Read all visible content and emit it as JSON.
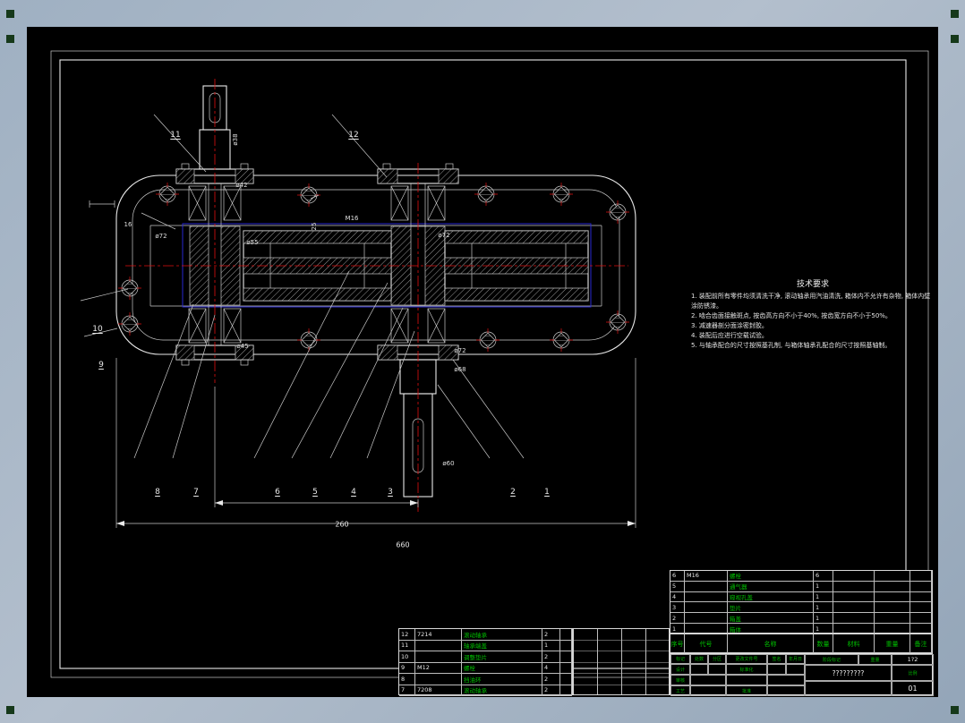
{
  "scene": {
    "background": "#a9b6c5",
    "canvas": "#000000",
    "line_color": "#e8e8e8",
    "centerline_color": "#e01010",
    "gear_box_color": "#2828d0",
    "table_text_color": "#00c000"
  },
  "callouts": [
    "1",
    "2",
    "3",
    "4",
    "5",
    "6",
    "7",
    "8",
    "9",
    "10",
    "11",
    "12"
  ],
  "dims": {
    "center_distance": "260",
    "overall_width": "660",
    "left_offset": "16",
    "left_dia": "ø72"
  },
  "labels": {
    "shaft_end": "ø38",
    "shaft_step": "ø42",
    "bearing_seat_top": "ø55",
    "bearing_seat_bottom": "ø45",
    "bolt_spec": "M16",
    "cap_depth": "25",
    "out_top": "ø72",
    "out_seat": "ø72",
    "out_cap": "ø68",
    "out_end": "ø60"
  },
  "tech": {
    "title": "技术要求",
    "lines": [
      "1. 装配前所有零件均须清洗干净, 滚动轴承用汽油清洗, 箱体内不允许有杂物, 箱体内壁涂防锈漆。",
      "2. 啮合齿面接触斑点, 按齿高方向不小于40%, 按齿宽方向不小于50%。",
      "3. 减速器剖分面涂密封胶。",
      "4. 装配后应进行空载试验。",
      "5. 与轴承配合的尺寸按照基孔制, 与箱体轴承孔配合的尺寸按照基轴制。"
    ]
  },
  "bom_left": {
    "rows": [
      [
        "12",
        "7214",
        "滚动轴承",
        "2",
        ""
      ],
      [
        "11",
        "",
        "轴承端盖",
        "1",
        ""
      ],
      [
        "10",
        "",
        "调整垫片",
        "2",
        ""
      ],
      [
        "9",
        "M12",
        "螺栓",
        "4",
        ""
      ],
      [
        "8",
        "",
        "挡油环",
        "2",
        ""
      ],
      [
        "7",
        "7208",
        "滚动轴承",
        "2",
        ""
      ]
    ]
  },
  "bom_right": {
    "header": [
      [
        "序号",
        "代号",
        "名称",
        "数量",
        "材料",
        "重量",
        "备注"
      ]
    ],
    "rows": [
      [
        "6",
        "M16",
        "螺栓",
        "6",
        "",
        "",
        ""
      ],
      [
        "5",
        "",
        "通气器",
        "1",
        "",
        "",
        ""
      ],
      [
        "4",
        "",
        "窥视孔盖",
        "1",
        "",
        "",
        ""
      ],
      [
        "3",
        "",
        "垫片",
        "1",
        "",
        "",
        ""
      ],
      [
        "2",
        "",
        "箱盖",
        "1",
        "",
        "",
        ""
      ],
      [
        "1",
        "",
        "箱体",
        "1",
        "",
        "",
        ""
      ]
    ]
  },
  "title_block": {
    "mark": "标记",
    "count": "处数",
    "zone": "分区",
    "change_file": "更改文件号",
    "sign": "签名",
    "date": "年月日",
    "design": "设计",
    "standardize": "标准化",
    "review": "审核",
    "craft": "工艺",
    "approve": "批准",
    "stage": "阶段标记",
    "weight": "重量",
    "scale": "比例",
    "scale_value": "1?2",
    "doc_title": "?????????",
    "sheet": "01"
  }
}
